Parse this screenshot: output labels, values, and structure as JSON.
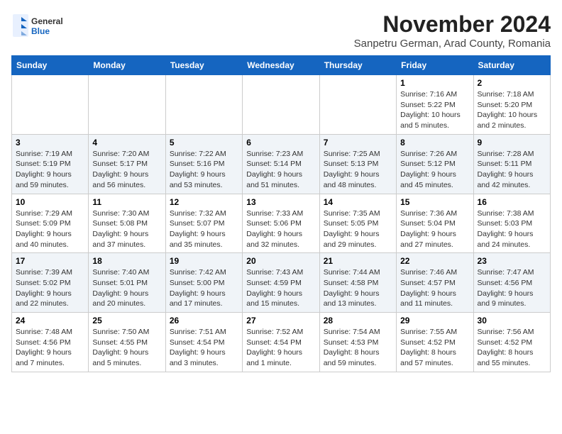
{
  "logo": {
    "text_general": "General",
    "text_blue": "Blue"
  },
  "header": {
    "month_title": "November 2024",
    "subtitle": "Sanpetru German, Arad County, Romania"
  },
  "weekdays": [
    "Sunday",
    "Monday",
    "Tuesday",
    "Wednesday",
    "Thursday",
    "Friday",
    "Saturday"
  ],
  "weeks": [
    [
      {
        "day": "",
        "info": ""
      },
      {
        "day": "",
        "info": ""
      },
      {
        "day": "",
        "info": ""
      },
      {
        "day": "",
        "info": ""
      },
      {
        "day": "",
        "info": ""
      },
      {
        "day": "1",
        "info": "Sunrise: 7:16 AM\nSunset: 5:22 PM\nDaylight: 10 hours and 5 minutes."
      },
      {
        "day": "2",
        "info": "Sunrise: 7:18 AM\nSunset: 5:20 PM\nDaylight: 10 hours and 2 minutes."
      }
    ],
    [
      {
        "day": "3",
        "info": "Sunrise: 7:19 AM\nSunset: 5:19 PM\nDaylight: 9 hours and 59 minutes."
      },
      {
        "day": "4",
        "info": "Sunrise: 7:20 AM\nSunset: 5:17 PM\nDaylight: 9 hours and 56 minutes."
      },
      {
        "day": "5",
        "info": "Sunrise: 7:22 AM\nSunset: 5:16 PM\nDaylight: 9 hours and 53 minutes."
      },
      {
        "day": "6",
        "info": "Sunrise: 7:23 AM\nSunset: 5:14 PM\nDaylight: 9 hours and 51 minutes."
      },
      {
        "day": "7",
        "info": "Sunrise: 7:25 AM\nSunset: 5:13 PM\nDaylight: 9 hours and 48 minutes."
      },
      {
        "day": "8",
        "info": "Sunrise: 7:26 AM\nSunset: 5:12 PM\nDaylight: 9 hours and 45 minutes."
      },
      {
        "day": "9",
        "info": "Sunrise: 7:28 AM\nSunset: 5:11 PM\nDaylight: 9 hours and 42 minutes."
      }
    ],
    [
      {
        "day": "10",
        "info": "Sunrise: 7:29 AM\nSunset: 5:09 PM\nDaylight: 9 hours and 40 minutes."
      },
      {
        "day": "11",
        "info": "Sunrise: 7:30 AM\nSunset: 5:08 PM\nDaylight: 9 hours and 37 minutes."
      },
      {
        "day": "12",
        "info": "Sunrise: 7:32 AM\nSunset: 5:07 PM\nDaylight: 9 hours and 35 minutes."
      },
      {
        "day": "13",
        "info": "Sunrise: 7:33 AM\nSunset: 5:06 PM\nDaylight: 9 hours and 32 minutes."
      },
      {
        "day": "14",
        "info": "Sunrise: 7:35 AM\nSunset: 5:05 PM\nDaylight: 9 hours and 29 minutes."
      },
      {
        "day": "15",
        "info": "Sunrise: 7:36 AM\nSunset: 5:04 PM\nDaylight: 9 hours and 27 minutes."
      },
      {
        "day": "16",
        "info": "Sunrise: 7:38 AM\nSunset: 5:03 PM\nDaylight: 9 hours and 24 minutes."
      }
    ],
    [
      {
        "day": "17",
        "info": "Sunrise: 7:39 AM\nSunset: 5:02 PM\nDaylight: 9 hours and 22 minutes."
      },
      {
        "day": "18",
        "info": "Sunrise: 7:40 AM\nSunset: 5:01 PM\nDaylight: 9 hours and 20 minutes."
      },
      {
        "day": "19",
        "info": "Sunrise: 7:42 AM\nSunset: 5:00 PM\nDaylight: 9 hours and 17 minutes."
      },
      {
        "day": "20",
        "info": "Sunrise: 7:43 AM\nSunset: 4:59 PM\nDaylight: 9 hours and 15 minutes."
      },
      {
        "day": "21",
        "info": "Sunrise: 7:44 AM\nSunset: 4:58 PM\nDaylight: 9 hours and 13 minutes."
      },
      {
        "day": "22",
        "info": "Sunrise: 7:46 AM\nSunset: 4:57 PM\nDaylight: 9 hours and 11 minutes."
      },
      {
        "day": "23",
        "info": "Sunrise: 7:47 AM\nSunset: 4:56 PM\nDaylight: 9 hours and 9 minutes."
      }
    ],
    [
      {
        "day": "24",
        "info": "Sunrise: 7:48 AM\nSunset: 4:56 PM\nDaylight: 9 hours and 7 minutes."
      },
      {
        "day": "25",
        "info": "Sunrise: 7:50 AM\nSunset: 4:55 PM\nDaylight: 9 hours and 5 minutes."
      },
      {
        "day": "26",
        "info": "Sunrise: 7:51 AM\nSunset: 4:54 PM\nDaylight: 9 hours and 3 minutes."
      },
      {
        "day": "27",
        "info": "Sunrise: 7:52 AM\nSunset: 4:54 PM\nDaylight: 9 hours and 1 minute."
      },
      {
        "day": "28",
        "info": "Sunrise: 7:54 AM\nSunset: 4:53 PM\nDaylight: 8 hours and 59 minutes."
      },
      {
        "day": "29",
        "info": "Sunrise: 7:55 AM\nSunset: 4:52 PM\nDaylight: 8 hours and 57 minutes."
      },
      {
        "day": "30",
        "info": "Sunrise: 7:56 AM\nSunset: 4:52 PM\nDaylight: 8 hours and 55 minutes."
      }
    ]
  ]
}
